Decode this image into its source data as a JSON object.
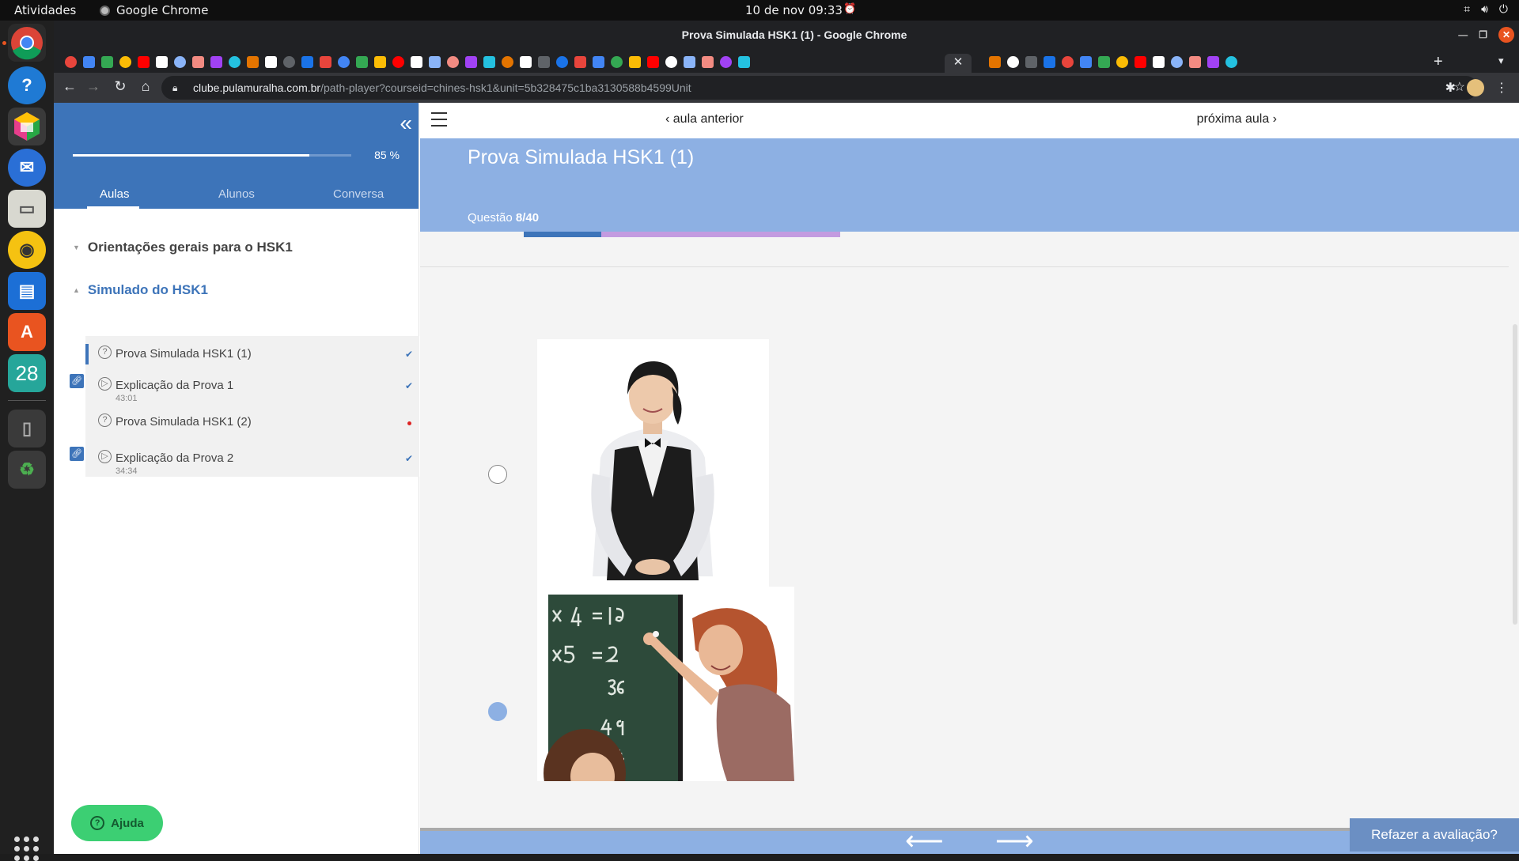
{
  "os": {
    "activities": "Atividades",
    "app_name": "Google Chrome",
    "clock": "10 de nov  09:33"
  },
  "window": {
    "title": "Prova Simulada HSK1 (1) - Google Chrome"
  },
  "address_bar": {
    "host": "clube.pulamuralha.com.br",
    "path": "/path-player?courseid=chines-hsk1&unit=5b328475c1ba3130588b4599Unit"
  },
  "sidebar": {
    "progress_label": "85 %",
    "progress": 0.85,
    "tabs": [
      "Aulas",
      "Alunos",
      "Conversa"
    ],
    "modules": [
      {
        "title": "Orientações gerais para o HSK1"
      },
      {
        "title": "Simulado do HSK1"
      }
    ],
    "lessons": [
      {
        "title": "Prova Simulada HSK1 (1)",
        "duration": "",
        "status": "done"
      },
      {
        "title": "Explicação da Prova 1",
        "duration": "43:01",
        "status": "done"
      },
      {
        "title": "Prova Simulada HSK1 (2)",
        "duration": "",
        "status": "pending"
      },
      {
        "title": "Explicação da Prova 2",
        "duration": "34:34",
        "status": "done"
      }
    ],
    "help_label": "Ajuda"
  },
  "nav": {
    "prev": "aula anterior",
    "next": "próxima aula"
  },
  "question": {
    "title": "Prova Simulada HSK1 (1)",
    "label": "Questão",
    "count": "8/40",
    "selected_option": 2
  },
  "footer": {
    "redo": "Refazer a avaliação?"
  },
  "colors": {
    "header_blue": "#3d74b9",
    "light_blue": "#8db0e3",
    "purple_bar": "#c39be0",
    "help_green": "#3ccf73"
  }
}
